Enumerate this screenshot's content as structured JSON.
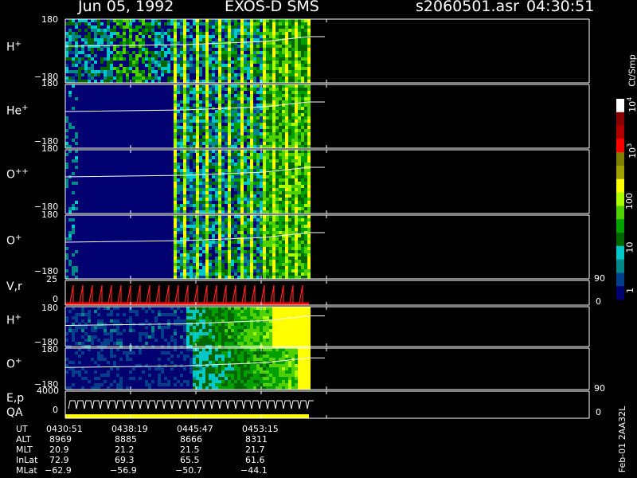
{
  "header": {
    "date": "Jun 05, 1992",
    "instrument": "EXOS-D SMS",
    "file": "s2060501.asr",
    "time": "04:30:51"
  },
  "colorbar": {
    "unit": "Ct/Smp",
    "tick_labels": [
      "10",
      "4",
      "10",
      "3",
      "100",
      "10",
      "1"
    ],
    "colors": [
      "#ffffff",
      "#8b0000",
      "#b00000",
      "#ff0000",
      "#808000",
      "#a0a000",
      "#ffff00",
      "#aaff00",
      "#50d000",
      "#00a000",
      "#006600",
      "#00c8c8",
      "#008888",
      "#00408a",
      "#000070"
    ]
  },
  "panels": [
    {
      "label": "H",
      "sup": "+",
      "ymax": "180",
      "ymin": "−180"
    },
    {
      "label": "He",
      "sup": "+",
      "ymax": "180",
      "ymin": "−180"
    },
    {
      "label": "O",
      "sup": "++",
      "ymax": "180",
      "ymin": "−180"
    },
    {
      "label": "O",
      "sup": "+",
      "ymax": "180",
      "ymin": "−180"
    },
    {
      "label": "V,r",
      "ymax": "25",
      "ymin": "0",
      "right_top": "90",
      "right_bottom": "0"
    },
    {
      "label": "H",
      "sup": "+",
      "ymax": "180",
      "ymin": "−180"
    },
    {
      "label": "O",
      "sup": "+",
      "ymax": "180",
      "ymin": "−180"
    },
    {
      "label": "E,p",
      "label2": "QA",
      "ymax": "4000",
      "ymin": "0",
      "right_top": "90",
      "right_bottom": "0"
    }
  ],
  "ephemeris": {
    "row_labels": [
      "UT",
      "ALT",
      "MLT",
      "InLat",
      "MLat"
    ],
    "columns": [
      {
        "UT": "0430:51",
        "ALT": "8969",
        "MLT": "20.9",
        "InLat": "72.9",
        "MLat": "−62.9"
      },
      {
        "UT": "0438:19",
        "ALT": "8885",
        "MLT": "21.2",
        "InLat": "69.3",
        "MLat": "−56.9"
      },
      {
        "UT": "0445:47",
        "ALT": "8666",
        "MLT": "21.5",
        "InLat": "65.5",
        "MLat": "−50.7"
      },
      {
        "UT": "0453:15",
        "ALT": "8311",
        "MLT": "21.7",
        "InLat": "61.6",
        "MLat": "−44.1"
      }
    ]
  },
  "footer_vertical": "Feb-01 2AA32L",
  "chart_data": {
    "type": "heatmap",
    "title": "Jun 05, 1992   EXOS-D SMS",
    "xlabel": "UT",
    "x_ticks": [
      "0430:51",
      "0438:19",
      "0445:47",
      "0453:15"
    ],
    "series": [
      {
        "name": "H+",
        "ylim": [
          -180,
          180
        ]
      },
      {
        "name": "He+",
        "ylim": [
          -180,
          180
        ]
      },
      {
        "name": "O++",
        "ylim": [
          -180,
          180
        ]
      },
      {
        "name": "O+",
        "ylim": [
          -180,
          180
        ]
      },
      {
        "name": "V,r",
        "ylim": [
          0,
          25
        ]
      },
      {
        "name": "H+",
        "ylim": [
          -180,
          180
        ]
      },
      {
        "name": "O+",
        "ylim": [
          -180,
          180
        ]
      },
      {
        "name": "E,p",
        "ylim": [
          0,
          4000
        ]
      }
    ],
    "colorscale": {
      "label": "Ct/Smp",
      "log": true,
      "range": [
        1,
        10000
      ]
    }
  }
}
